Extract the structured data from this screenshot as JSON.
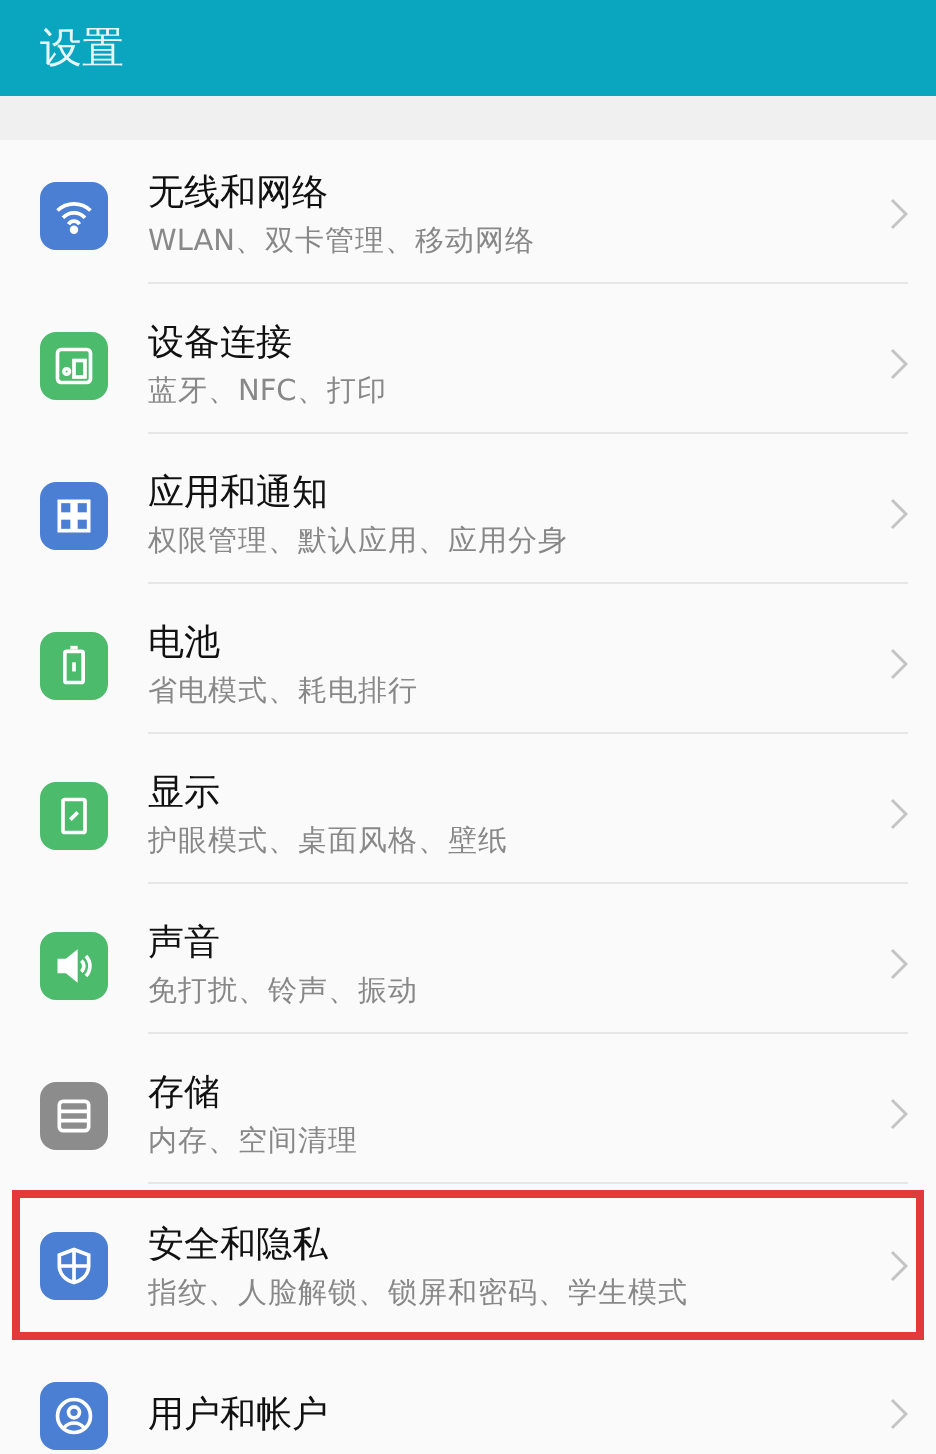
{
  "header": {
    "title": "设置"
  },
  "items": [
    {
      "kind": "wifi",
      "color": "#4a7fd4",
      "title": "无线和网络",
      "subtitle": "WLAN、双卡管理、移动网络",
      "highlighted": false
    },
    {
      "kind": "devices",
      "color": "#4cbb6c",
      "title": "设备连接",
      "subtitle": "蓝牙、NFC、打印",
      "highlighted": false
    },
    {
      "kind": "apps",
      "color": "#4a7fd4",
      "title": "应用和通知",
      "subtitle": "权限管理、默认应用、应用分身",
      "highlighted": false
    },
    {
      "kind": "battery",
      "color": "#4cbb6c",
      "title": "电池",
      "subtitle": "省电模式、耗电排行",
      "highlighted": false
    },
    {
      "kind": "display",
      "color": "#4cbb6c",
      "title": "显示",
      "subtitle": "护眼模式、桌面风格、壁纸",
      "highlighted": false
    },
    {
      "kind": "sound",
      "color": "#4cbb6c",
      "title": "声音",
      "subtitle": "免打扰、铃声、振动",
      "highlighted": false
    },
    {
      "kind": "storage",
      "color": "#8c8c8c",
      "title": "存储",
      "subtitle": "内存、空间清理",
      "highlighted": false
    },
    {
      "kind": "shield",
      "color": "#4a7fd4",
      "title": "安全和隐私",
      "subtitle": "指纹、人脸解锁、锁屏和密码、学生模式",
      "highlighted": true
    },
    {
      "kind": "user",
      "color": "#4a7fd4",
      "title": "用户和帐户",
      "highlighted": false
    }
  ]
}
